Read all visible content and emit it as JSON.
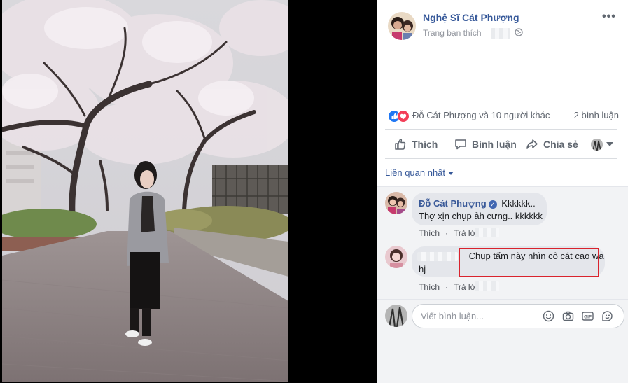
{
  "post": {
    "page_name": "Nghệ Sĩ Cát Phượng",
    "page_sub": "Trang bạn thích",
    "more_label": "•••",
    "reactions_text": "Đỗ Cát Phượng và 10 người khác",
    "comment_count": "2 bình luận"
  },
  "actions": {
    "like": "Thích",
    "comment": "Bình luận",
    "share": "Chia sẻ"
  },
  "sort_label": "Liên quan nhất",
  "comments": [
    {
      "author": "Đỗ Cát Phượng",
      "text": "Kkkkkk..",
      "text2": "Thợ xịn chụp ảh cưng.. kkkkkk",
      "like": "Thích",
      "reply": "Trả lời"
    },
    {
      "text": "Chụp tấm này nhìn cô cát cao wa",
      "text2": "hj",
      "like": "Thích",
      "reply": "Trả lời"
    }
  ],
  "composer": {
    "placeholder": "Viết bình luận..."
  },
  "colors": {
    "link_blue": "#365899",
    "like_blue": "#2078f4",
    "love_red": "#f33e58",
    "highlight_red": "#d9232d"
  }
}
